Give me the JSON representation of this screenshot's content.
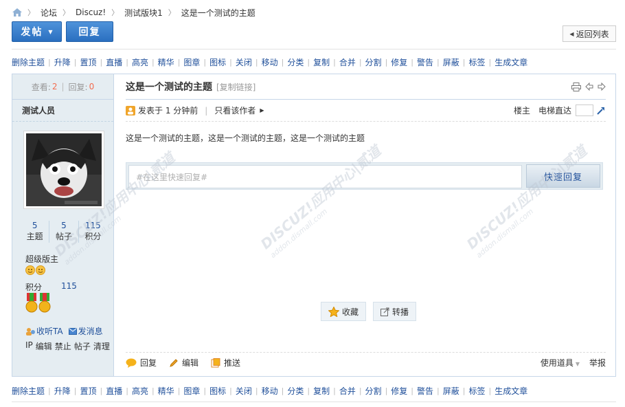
{
  "breadcrumb": {
    "items": [
      "论坛",
      "Discuz!",
      "测试版块1",
      "这是一个测试的主题"
    ]
  },
  "toolbar": {
    "post_label": "发帖",
    "reply_label": "回复",
    "back_label": "返回列表"
  },
  "modbar": {
    "items": [
      "删除主题",
      "升降",
      "置顶",
      "直播",
      "高亮",
      "精华",
      "图章",
      "图标",
      "关闭",
      "移动",
      "分类",
      "复制",
      "合并",
      "分割",
      "修复",
      "警告",
      "屏蔽",
      "标签",
      "生成文章"
    ]
  },
  "thread": {
    "views_label": "查看:",
    "views": "2",
    "replies_label": "回复:",
    "replies": "0",
    "title": "这是一个测试的主题",
    "copy_link": "[复制链接]"
  },
  "author": {
    "name": "测试人员",
    "threads": "5",
    "threads_label": "主题",
    "posts": "5",
    "posts_label": "帖子",
    "credits": "115",
    "credits_label": "积分",
    "group": "超级版主",
    "credit_row_label": "积分",
    "credit_row_value": "115",
    "follow_label": "收听TA",
    "message_label": "发消息",
    "admin_links": [
      "IP",
      "编辑",
      "禁止",
      "帖子",
      "清理"
    ]
  },
  "post": {
    "posted_label": "发表于 1 分钟前",
    "only_author": "只看该作者",
    "floor": "楼主",
    "elevator": "电梯直达",
    "content": "这是一个测试的主题，这是一个测试的主题，这是一个测试的主题"
  },
  "quick_reply": {
    "placeholder": "#在这里快速回复#",
    "button": "快速回复"
  },
  "actions": {
    "favorite": "收藏",
    "share": "转播"
  },
  "footer": {
    "reply": "回复",
    "edit": "编辑",
    "push": "推送",
    "tools": "使用道具",
    "report": "举报"
  },
  "watermark": {
    "main": "DISCUZ!应用中心|贰道",
    "sub": "addon.dismall.com"
  },
  "colors": {
    "link": "#1f4f9a",
    "accent": "#f26c4f",
    "sidebar_bg": "#e5edf2",
    "primary_button": "#2a6fc0"
  }
}
